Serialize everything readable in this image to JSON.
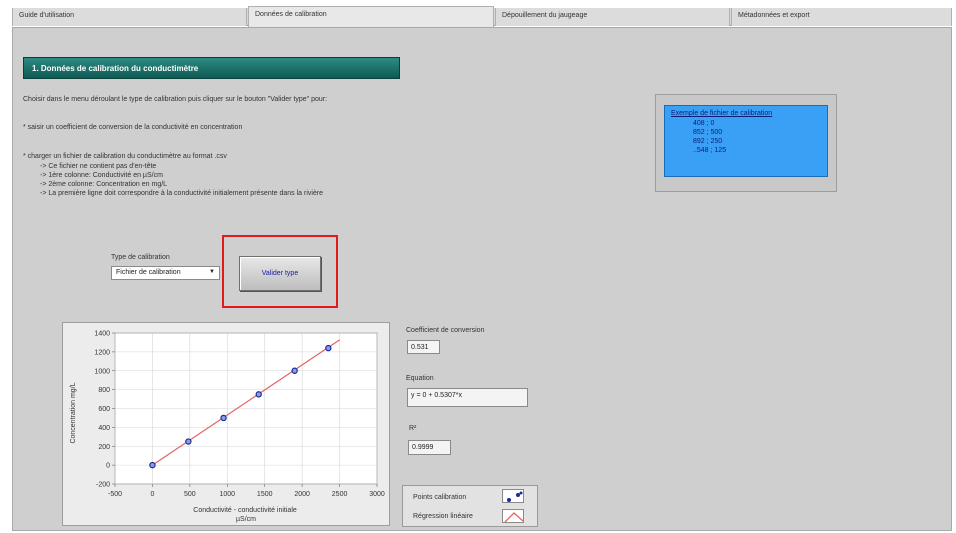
{
  "tabs": [
    {
      "label": "Guide d'utilisation",
      "active": false
    },
    {
      "label": "Données de calibration",
      "active": true
    },
    {
      "label": "Dépouillement du jaugeage",
      "active": false
    },
    {
      "label": "Métadonnées et export",
      "active": false
    }
  ],
  "section": {
    "title": "1. Données de calibration du conductimètre"
  },
  "instructions": {
    "intro": "Choisir dans le menu déroulant le type de calibration puis cliquer sur le bouton \"Valider type\" pour:",
    "bullet1": "* saisir un coefficient de conversion de la conductivité en concentration",
    "bullet2": "* charger un fichier de calibration du conductimètre au format .csv",
    "sub1": "-> Ce fichier ne contient pas d'en-tête",
    "sub2": "-> 1ère colonne: Conductivité en µS/cm",
    "sub3": "-> 2ème colonne: Concentration en mg/L",
    "sub4": "-> La première ligne doit correspondre à la conductivité initialement présente dans la rivière"
  },
  "example": {
    "title": "Exemple de fichier de calibration",
    "lines": [
      "408 ; 0",
      "852 ; 500",
      "892 ; 250",
      "..548 ; 125"
    ]
  },
  "calibration_type": {
    "label": "Type de calibration",
    "value": "Fichier de calibration"
  },
  "validate_button": {
    "label": "Valider type"
  },
  "outputs": {
    "coef_label": "Coefficient de conversion",
    "coef_value": "0.531",
    "equation_label": "Equation",
    "equation_value": "y = 0 + 0.5307*x",
    "r2_label": "R²",
    "r2_value": "0.9999"
  },
  "legend": {
    "points_label": "Points calibration",
    "regression_label": "Régression linéaire"
  },
  "colors": {
    "points": "#1a2a9a",
    "regression": "#e86060",
    "accent": "#0e5a54"
  },
  "chart_data": {
    "type": "scatter",
    "xlabel": "Conductivité - conductivité initiale µS/cm",
    "ylabel": "Concentration mg/L",
    "xlim": [
      -500,
      3000
    ],
    "ylim": [
      -200,
      1400
    ],
    "x_ticks": [
      -500,
      0,
      500,
      1000,
      1500,
      2000,
      2500,
      3000
    ],
    "y_ticks": [
      -200,
      0,
      200,
      400,
      600,
      800,
      1000,
      1200,
      1400
    ],
    "grid": true,
    "series": [
      {
        "name": "Points calibration",
        "kind": "points",
        "x": [
          0,
          480,
          950,
          1420,
          1900,
          2350
        ],
        "y": [
          0,
          250,
          500,
          750,
          1000,
          1240
        ]
      },
      {
        "name": "Régression linéaire",
        "kind": "line",
        "x": [
          -20,
          2500
        ],
        "y": [
          -10,
          1327
        ]
      }
    ]
  }
}
